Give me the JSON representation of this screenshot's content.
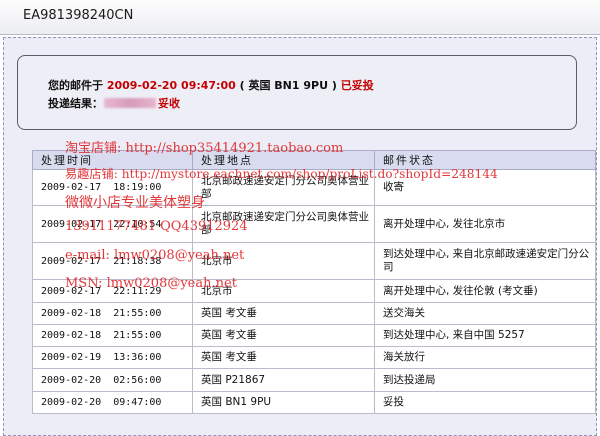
{
  "tracking_number": "EA981398240CN",
  "summary": {
    "mail_label": "您的邮件于",
    "datetime": "2009-02-20 09:47:00",
    "location": "( 英国 BN1 9PU )",
    "status": "已妥投",
    "result_label": "投递结果：",
    "result_tail": "妥收"
  },
  "table": {
    "headers": [
      "处理时间",
      "处理地点",
      "邮件状态"
    ],
    "rows": [
      {
        "time": "2009-02-17  18:19:00",
        "place": "北京邮政速递安定门分公司奥体营业部",
        "status": "收寄"
      },
      {
        "time": "2009-02-17  22:10:54",
        "place": "北京邮政速递安定门分公司奥体营业部",
        "status": "离开处理中心, 发往北京市"
      },
      {
        "time": "2009-02-17  21:18:38",
        "place": "北京市",
        "status": "到达处理中心, 来自北京邮政速递安定门分公司"
      },
      {
        "time": "2009-02-17  22:11:29",
        "place": "北京市",
        "status": "离开处理中心, 发往伦敦 (考文垂)"
      },
      {
        "time": "2009-02-18  21:55:00",
        "place": "英国 考文垂",
        "status": "送交海关"
      },
      {
        "time": "2009-02-18  21:55:00",
        "place": "英国 考文垂",
        "status": "到达处理中心, 来自中国 5257"
      },
      {
        "time": "2009-02-19  13:36:00",
        "place": "英国 考文垂",
        "status": "海关放行"
      },
      {
        "time": "2009-02-20  02:56:00",
        "place": "英国 P21867",
        "status": "到达投递局"
      },
      {
        "time": "2009-02-20  09:47:00",
        "place": "英国 BN1 9PU",
        "status": "妥投"
      }
    ]
  },
  "watermark": {
    "line1": "淘宝店铺: http://shop35414921.taobao.com",
    "line2": "易趣店铺: http://mystore.eachnet.com/shop/proList.do?shopId=248144",
    "line3": "微微小店专业美体塑身",
    "line4": "13911177481    QQ43912924",
    "line5": "e-mail: lmw0208@yeah.net",
    "line6": "MSN: lmw0208@yeah.net"
  }
}
